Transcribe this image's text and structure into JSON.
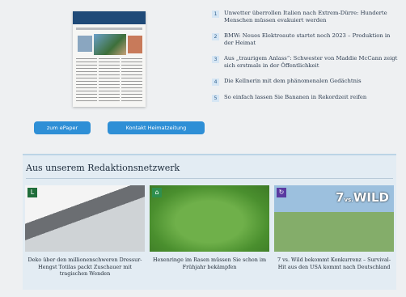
{
  "buttons": {
    "epaper": "zum ePaper",
    "kontakt": "Kontakt Heimatzeitung"
  },
  "top_list": [
    {
      "num": "1",
      "text": "Unwetter überrollen Italien nach Extrem-Dürre: Hunderte Menschen müssen evakuiert werden"
    },
    {
      "num": "2",
      "text": "BMW: Neues Elektroauto startet noch 2023 – Produktion in der Heimat"
    },
    {
      "num": "3",
      "text": "Aus „traurigem Anlass“: Schwester von Maddie McCann zeigt sich erstmals in der Öffentlichkeit"
    },
    {
      "num": "4",
      "text": "Die Kellnerin mit dem phänomenalen Gedächtnis"
    },
    {
      "num": "5",
      "text": "So einfach lassen Sie Bananen in Rekordzeit reifen"
    }
  ],
  "network": {
    "title": "Aus unserem Redaktionsnetzwerk",
    "cards": [
      {
        "badge": "L",
        "caption": "Deko über den millionenschweren Dressur-Hengst Totilas packt Zuschauer mit tragischen Wenden",
        "badge_color": "#1f6d3a"
      },
      {
        "badge": "",
        "caption": "Hexenringe im Rasen müssen Sie schon im Frühjahr bekämpfen",
        "badge_color": "#2f8f4e"
      },
      {
        "badge": "",
        "caption": "7 vs. Wild bekommt Konkurrenz – Survival-Hit aus den USA kommt nach Deutschland",
        "badge_color": "#5a3aa0"
      }
    ]
  },
  "wild_logo": {
    "prefix": "7",
    "small": "vs.",
    "word": "WILD"
  }
}
